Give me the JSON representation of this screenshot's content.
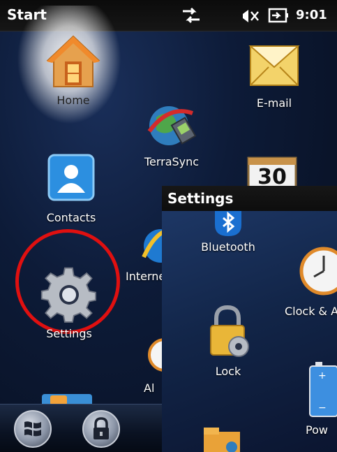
{
  "status_bar": {
    "title": "Start",
    "time": "9:01"
  },
  "start_tiles": {
    "home": "Home",
    "email": "E-mail",
    "terrasync": "TerraSync",
    "calendar_day": "30",
    "contacts": "Contacts",
    "internet": "Interne",
    "settings": "Settings",
    "alarms": "Al"
  },
  "settings_panel": {
    "title": "Settings",
    "items": {
      "bluetooth": "Bluetooth",
      "clock": "Clock & A",
      "lock": "Lock",
      "power": "Pow"
    }
  },
  "colors": {
    "highlight": "#e01010",
    "accent": "#1a7fd6"
  }
}
